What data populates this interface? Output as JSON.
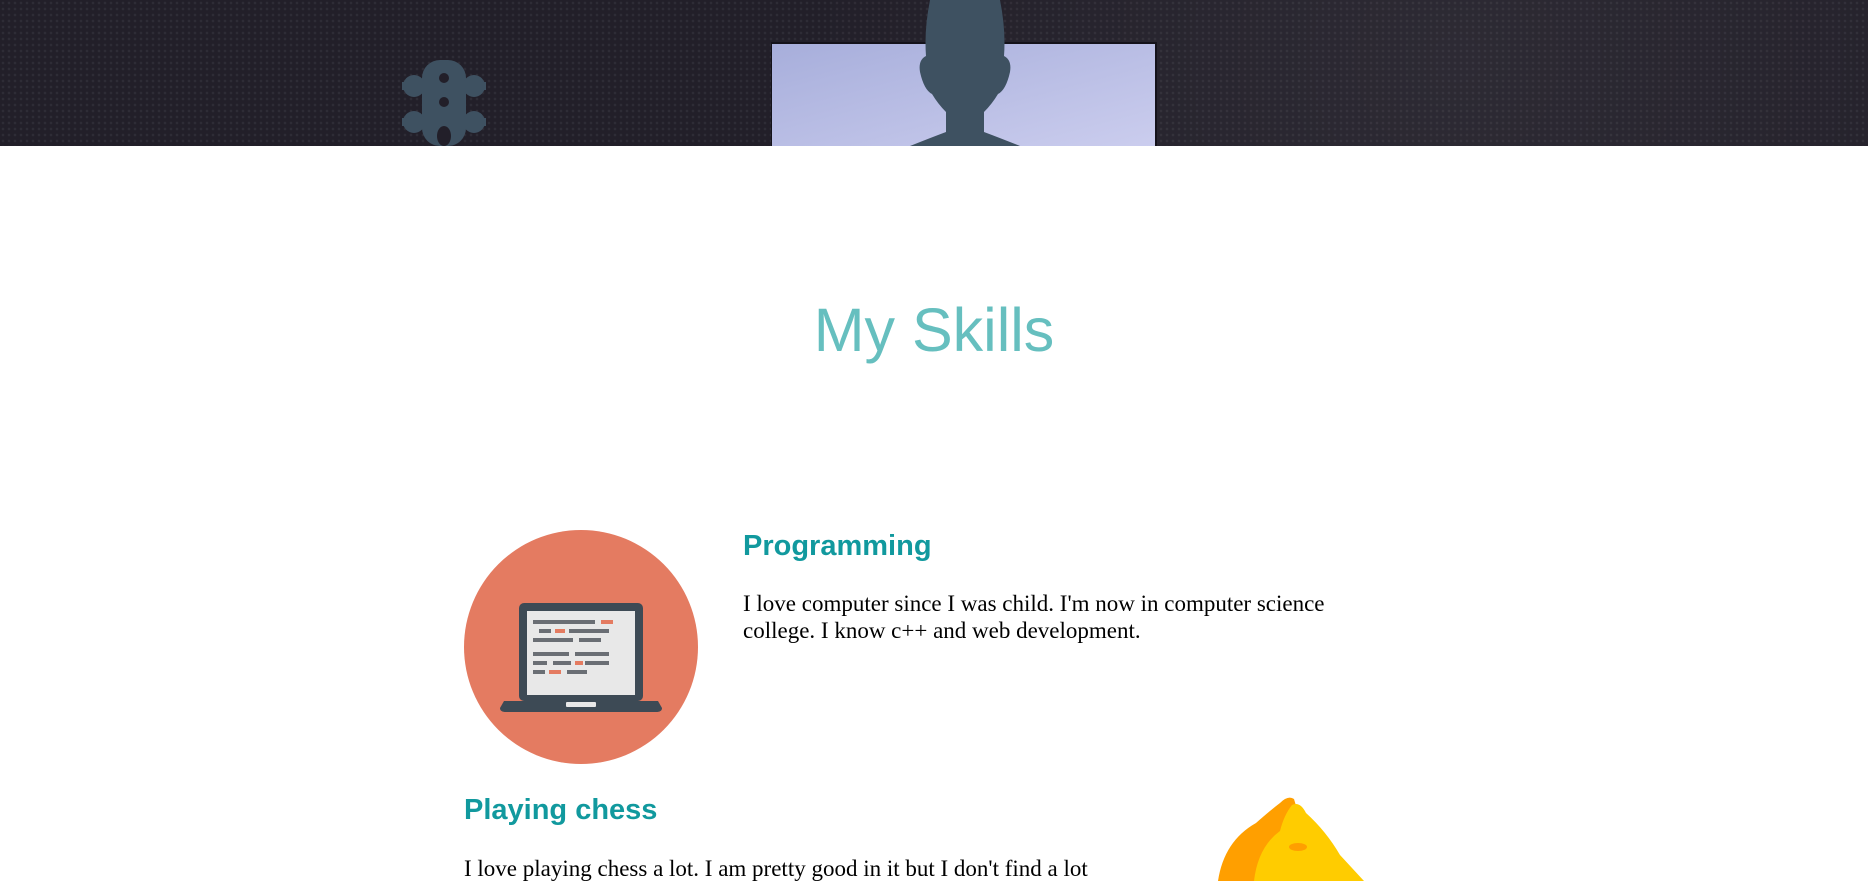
{
  "hero": {
    "icons": [
      "guitar-headstock-icon",
      "person-silhouette-icon",
      "monitor-screen-icon"
    ]
  },
  "skills": {
    "title": "My Skills",
    "items": [
      {
        "heading": "Programming",
        "text": "I love computer since I was child. I'm now in computer science college. I know c++ and web development.",
        "icon": "laptop-icon",
        "icon_bg_color": "#e47b61"
      },
      {
        "heading": "Playing chess",
        "text": "I love playing chess a lot. I am pretty good in it but I don't find a lot",
        "icon": "chess-knight-icon"
      }
    ]
  },
  "colors": {
    "title": "#66bfbf",
    "heading": "#11999e",
    "hero_bg": "#221f29"
  }
}
